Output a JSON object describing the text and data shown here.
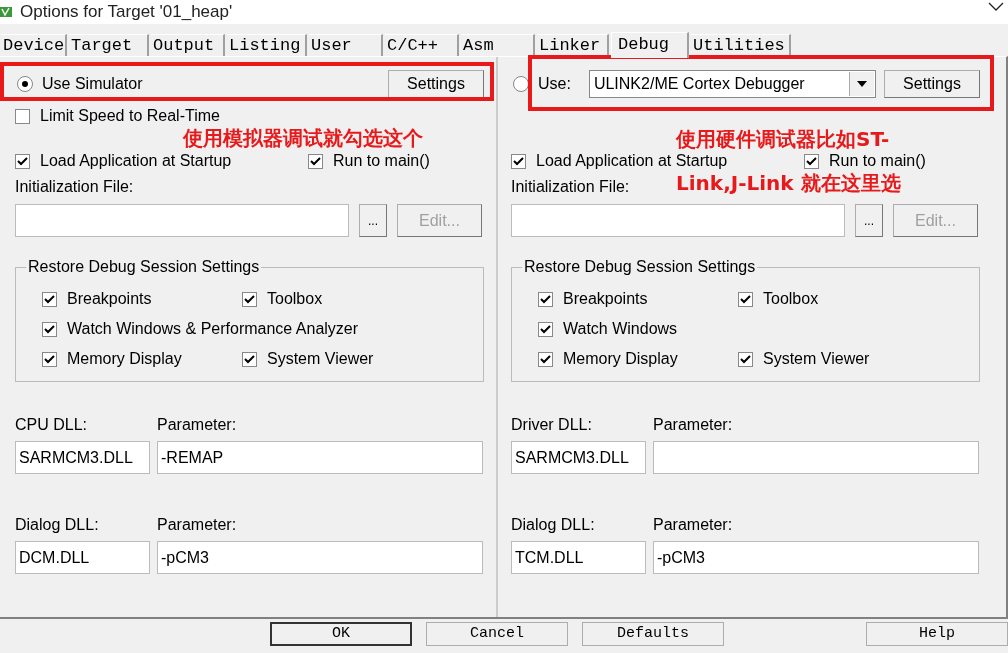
{
  "window": {
    "title": "Options for Target '01_heap'"
  },
  "tabs": [
    {
      "label": "Device",
      "selected": false
    },
    {
      "label": "Target",
      "selected": false
    },
    {
      "label": "Output",
      "selected": false
    },
    {
      "label": "Listing",
      "selected": false
    },
    {
      "label": "User",
      "selected": false
    },
    {
      "label": "C/C++",
      "selected": false
    },
    {
      "label": "Asm",
      "selected": false
    },
    {
      "label": "Linker",
      "selected": false
    },
    {
      "label": "Debug",
      "selected": true
    },
    {
      "label": "Utilities",
      "selected": false
    }
  ],
  "panels": [
    {
      "mode": {
        "kind": "simulator",
        "label": "Use Simulator",
        "selected": true
      },
      "settings_button": "Settings",
      "limit_speed": {
        "label": "Limit Speed to Real-Time",
        "checked": false
      },
      "load_application": {
        "label": "Load Application at Startup",
        "checked": true
      },
      "run_to_main": {
        "label": "Run to main()",
        "checked": true
      },
      "init_file_label": "Initialization File:",
      "browse_button": "...",
      "edit_button": {
        "label": "Edit...",
        "disabled": true
      },
      "restore_group": {
        "title": "Restore Debug Session Settings",
        "rows": [
          [
            {
              "label": "Breakpoints",
              "checked": true
            },
            {
              "label": "Toolbox",
              "checked": true
            }
          ],
          [
            {
              "label": "Watch Windows & Performance Analyzer",
              "checked": true
            }
          ],
          [
            {
              "label": "Memory Display",
              "checked": true
            },
            {
              "label": "System Viewer",
              "checked": true
            }
          ]
        ]
      },
      "dll_rows": [
        {
          "dll_label": "CPU DLL:",
          "dll": "SARMCM3.DLL",
          "param_label": "Parameter:",
          "param": "-REMAP"
        },
        {
          "dll_label": "Dialog DLL:",
          "dll": "DCM.DLL",
          "param_label": "Parameter:",
          "param": "-pCM3"
        }
      ]
    },
    {
      "mode": {
        "kind": "target",
        "label": "Use:",
        "selected": false,
        "driver": "ULINK2/ME Cortex Debugger"
      },
      "settings_button": "Settings",
      "load_application": {
        "label": "Load Application at Startup",
        "checked": true
      },
      "run_to_main": {
        "label": "Run to main()",
        "checked": true
      },
      "init_file_label": "Initialization File:",
      "browse_button": "...",
      "edit_button": {
        "label": "Edit...",
        "disabled": true
      },
      "restore_group": {
        "title": "Restore Debug Session Settings",
        "rows": [
          [
            {
              "label": "Breakpoints",
              "checked": true
            },
            {
              "label": "Toolbox",
              "checked": true
            }
          ],
          [
            {
              "label": "Watch Windows",
              "checked": true
            }
          ],
          [
            {
              "label": "Memory Display",
              "checked": true
            },
            {
              "label": "System Viewer",
              "checked": true
            }
          ]
        ]
      },
      "dll_rows": [
        {
          "dll_label": "Driver DLL:",
          "dll": "SARMCM3.DLL",
          "param_label": "Parameter:"
        },
        {
          "dll_label": "Dialog DLL:",
          "dll": "TCM.DLL",
          "param_label": "Parameter:",
          "param": "-pCM3"
        }
      ]
    }
  ],
  "annotations": [
    {
      "lines": [
        "使用模拟器调试就勾选这个"
      ]
    },
    {
      "lines": [
        "使用硬件调试器比如ST-",
        "Link,J-Link  就在这里选"
      ]
    }
  ],
  "buttons": [
    "OK",
    "Cancel",
    "Defaults",
    "Help"
  ]
}
